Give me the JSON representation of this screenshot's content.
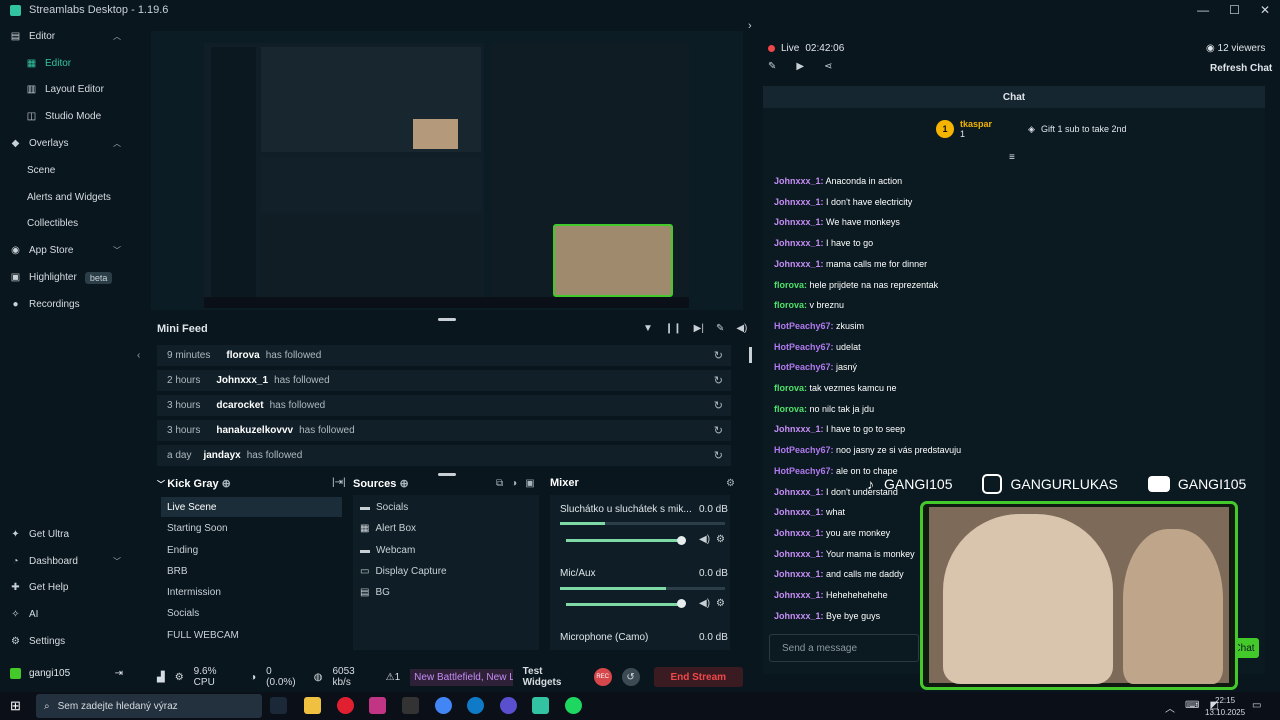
{
  "title_bar": {
    "app_title": "Streamlabs Desktop - 1.19.6"
  },
  "sidebar": {
    "items": [
      {
        "label": "Editor",
        "icon": "editor-icon"
      },
      {
        "label": "Editor",
        "icon": "editor-sub-icon"
      },
      {
        "label": "Layout Editor",
        "icon": "layout-icon"
      },
      {
        "label": "Studio Mode",
        "icon": "studio-icon"
      },
      {
        "label": "Overlays",
        "icon": "overlays-icon"
      },
      {
        "label": "Scene"
      },
      {
        "label": "Alerts and Widgets"
      },
      {
        "label": "Collectibles"
      },
      {
        "label": "App Store",
        "icon": "store-icon"
      },
      {
        "label": "Highlighter",
        "badge": "beta"
      },
      {
        "label": "Recordings",
        "icon": "recordings-icon"
      }
    ],
    "bottom": [
      {
        "label": "Get Ultra"
      },
      {
        "label": "Dashboard"
      },
      {
        "label": "Get Help"
      },
      {
        "label": "AI"
      },
      {
        "label": "Settings"
      }
    ],
    "user": "gangi105"
  },
  "mini_feed": {
    "title": "Mini Feed",
    "rows": [
      {
        "time": "9 minutes",
        "user": "florova",
        "action": "has followed"
      },
      {
        "time": "2 hours",
        "user": "Johnxxx_1",
        "action": "has followed"
      },
      {
        "time": "3 hours",
        "user": "dcarocket",
        "action": "has followed"
      },
      {
        "time": "3 hours",
        "user": "hanakuzelkovvv",
        "action": "has followed"
      },
      {
        "time": "a day",
        "user": "jandayx",
        "action": "has followed"
      }
    ]
  },
  "scenes": {
    "header": "Kick Gray",
    "items": [
      "Live Scene",
      "Starting Soon",
      "Ending",
      "BRB",
      "Intermission",
      "Socials",
      "FULL WEBCAM"
    ]
  },
  "sources": {
    "header": "Sources",
    "items": [
      "Socials",
      "Alert Box",
      "Webcam",
      "Display Capture",
      "BG"
    ]
  },
  "mixer": {
    "header": "Mixer",
    "channels": [
      {
        "name": "Sluchátko u sluchátek s mik...",
        "db": "0.0 dB",
        "level": 0.95
      },
      {
        "name": "Mic/Aux",
        "db": "0.0 dB",
        "level": 0.95
      },
      {
        "name": "Microphone (Camo)",
        "db": "0.0 dB"
      }
    ]
  },
  "footer": {
    "cpu": "9.6% CPU",
    "dropped": "0 (0.0%)",
    "bitrate": "6053 kb/s",
    "alerts": "1",
    "ticker": "New Battlefield, New Lo",
    "test_widgets": "Test Widgets",
    "rec": "REC",
    "end_stream": "End Stream"
  },
  "chat": {
    "live_label": "Live",
    "live_time": "02:42:06",
    "viewers": "12 viewers",
    "refresh": "Refresh Chat",
    "header": "Chat",
    "pinned_user": "tkaspar",
    "pinned_count": "1",
    "gift_text": "Gift 1 sub to take 2nd",
    "messages": [
      {
        "user": "Johnxxx_1:",
        "text": "Anaconda in action",
        "color": "#c58cf5"
      },
      {
        "user": "Johnxxx_1:",
        "text": "I don't have electricity",
        "color": "#c58cf5"
      },
      {
        "user": "Johnxxx_1:",
        "text": "We have monkeys",
        "color": "#c58cf5"
      },
      {
        "user": "Johnxxx_1:",
        "text": "I have to go",
        "color": "#c58cf5"
      },
      {
        "user": "Johnxxx_1:",
        "text": "mama calls me for dinner",
        "color": "#c58cf5"
      },
      {
        "user": "florova:",
        "text": "hele prijdete na nas reprezentak",
        "color": "#4fe06a"
      },
      {
        "user": "florova:",
        "text": "v breznu",
        "color": "#4fe06a"
      },
      {
        "user": "HotPeachy67:",
        "text": "zkusim",
        "color": "#b179f0"
      },
      {
        "user": "HotPeachy67:",
        "text": "udelat",
        "color": "#b179f0"
      },
      {
        "user": "HotPeachy67:",
        "text": "jasný",
        "color": "#b179f0"
      },
      {
        "user": "florova:",
        "text": "tak vezmes kamcu ne",
        "color": "#4fe06a"
      },
      {
        "user": "florova:",
        "text": "no nilc tak ja jdu",
        "color": "#4fe06a"
      },
      {
        "user": "Johnxxx_1:",
        "text": "I have to go to seep",
        "color": "#c58cf5"
      },
      {
        "user": "HotPeachy67:",
        "text": "noo jasny ze si vás predstavuju",
        "color": "#b179f0"
      },
      {
        "user": "HotPeachy67:",
        "text": "ale on to chape",
        "color": "#b179f0"
      },
      {
        "user": "Johnxxx_1:",
        "text": "I don't understand",
        "color": "#c58cf5"
      },
      {
        "user": "Johnxxx_1:",
        "text": "what",
        "color": "#c58cf5"
      },
      {
        "user": "Johnxxx_1:",
        "text": "you are monkey",
        "color": "#c58cf5"
      },
      {
        "user": "Johnxxx_1:",
        "text": "Your mama is monkey",
        "color": "#c58cf5"
      },
      {
        "user": "Johnxxx_1:",
        "text": "and calls me daddy",
        "color": "#c58cf5"
      },
      {
        "user": "Johnxxx_1:",
        "text": "Hehehehehehe",
        "color": "#c58cf5"
      },
      {
        "user": "Johnxxx_1:",
        "text": "Bye bye guys",
        "color": "#c58cf5"
      }
    ],
    "input_placeholder": "Send a message",
    "send_label": "Chat"
  },
  "overlay": {
    "socials": [
      "GANGI105",
      "GANGURLUKAS",
      "GANGI105"
    ]
  },
  "taskbar": {
    "search_placeholder": "Sem zadejte hledaný výraz",
    "time": "22:15",
    "date": "13.10.2025"
  },
  "colors": {
    "accent": "#31c3a2",
    "end_stream": "#f0474b",
    "live_dot": "#f0474b",
    "overlay_green": "#44c92b"
  }
}
